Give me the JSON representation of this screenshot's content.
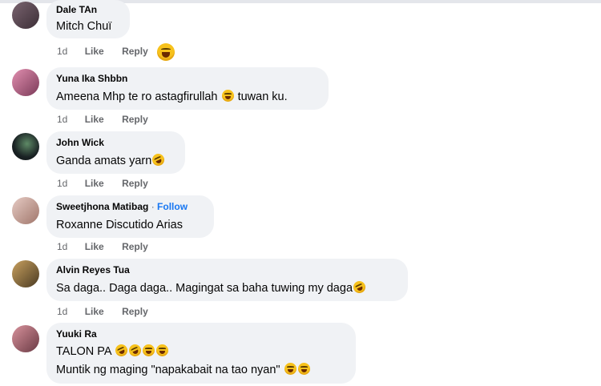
{
  "comments": [
    {
      "author": "Dale TAn",
      "lines": [
        "Mitch Chuï"
      ],
      "time": "1d",
      "like": "Like",
      "reply": "Reply",
      "reaction_icon": "laughing-emoji",
      "avatar_color": "#5b4a52"
    },
    {
      "author": "Yuna Ika Shbbn",
      "lines": [
        "Ameena Mhp te ro astagfirullah",
        "tuwan ku."
      ],
      "time": "1d",
      "like": "Like",
      "reply": "Reply",
      "avatar_color": "#b0577d"
    },
    {
      "author": "John Wick",
      "lines": [
        "Ganda amats yarn"
      ],
      "time": "1d",
      "like": "Like",
      "reply": "Reply",
      "avatar_color": "#1f2a2c"
    },
    {
      "author": "Sweetjhona Matibag",
      "dot": "·",
      "follow": "Follow",
      "lines": [
        "Roxanne Discutido Arias"
      ],
      "time": "1d",
      "like": "Like",
      "reply": "Reply",
      "avatar_color": "#c9a7a0"
    },
    {
      "author": "Alvin Reyes Tua",
      "lines": [
        "Sa daga.. Daga daga.. Magingat sa baha tuwing my daga"
      ],
      "time": "1d",
      "like": "Like",
      "reply": "Reply",
      "avatar_color": "#8a6a3a"
    },
    {
      "author": "Yuuki Ra",
      "lines": [
        "TALON PA",
        "Muntik ng maging \"napakabait na tao nyan\""
      ],
      "time": "1d",
      "like": "Like",
      "reply": "Reply",
      "avatar_color": "#9c5f6a"
    }
  ],
  "colors": {
    "bubble": "#f0f2f5",
    "secondary_text": "#65676b",
    "follow_blue": "#1877f2"
  }
}
